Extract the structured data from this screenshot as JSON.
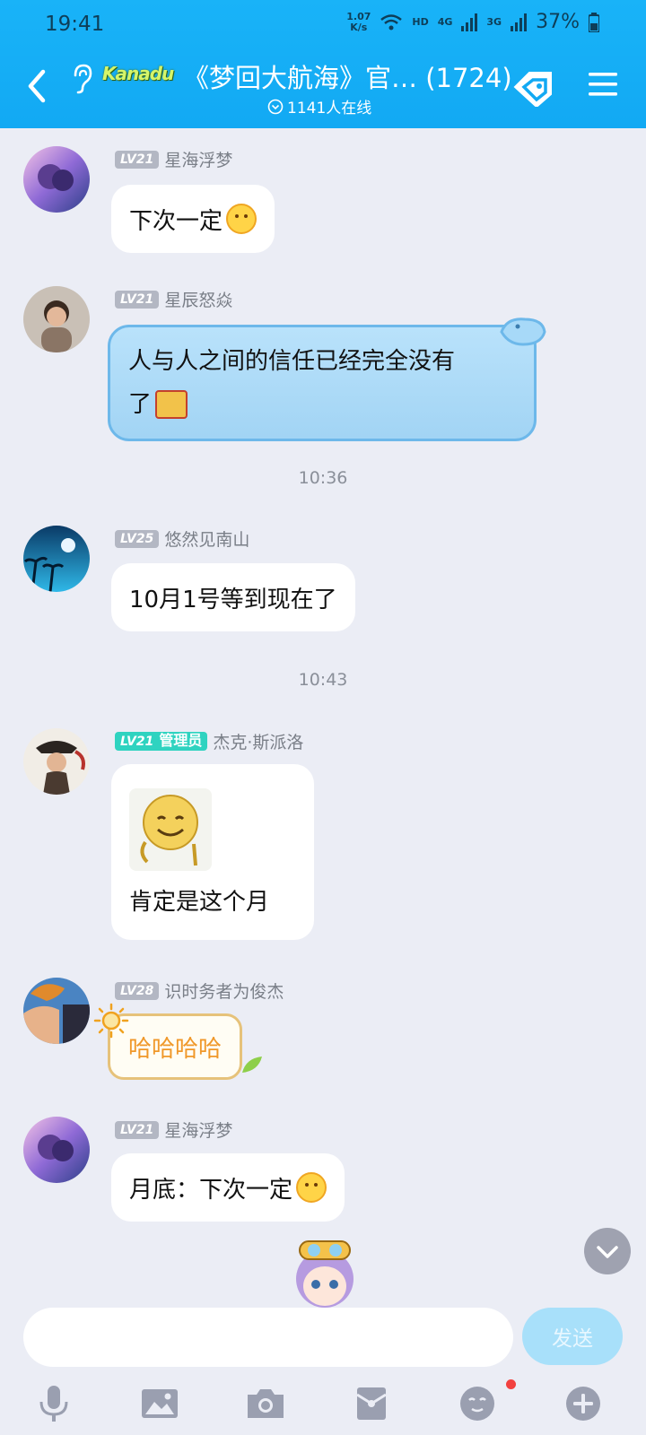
{
  "status_bar": {
    "time": "19:41",
    "net_speed_top": "1.07",
    "net_speed_bottom": "K/s",
    "hd": "HD",
    "net_4g": "4G",
    "net_3g": "3G",
    "battery": "37%"
  },
  "header": {
    "logo_text": "Kanadu",
    "title": "《梦回大航海》官…  (1724)",
    "online": "1141人在线"
  },
  "messages": [
    {
      "level": "LV21",
      "name": "星海浮梦",
      "text": "下次一定"
    },
    {
      "level": "LV21",
      "name": "星辰怒焱",
      "text_line1": "人与人之间的信任已经完全没有",
      "text_line2": "了"
    },
    {
      "level": "LV25",
      "name": "悠然见南山",
      "text": "10月1号等到现在了"
    },
    {
      "level": "LV21",
      "role": "管理员",
      "name": "杰克·斯派洛",
      "text": "肯定是这个月"
    },
    {
      "level": "LV28",
      "name": "识时务者为俊杰",
      "text": "哈哈哈哈"
    },
    {
      "level": "LV21",
      "name": "星海浮梦",
      "text": "月底：下次一定"
    }
  ],
  "timestamps": [
    "10:36",
    "10:43"
  ],
  "input": {
    "placeholder": "",
    "send_label": "发送"
  },
  "toolbar": {
    "icons": [
      "microphone-icon",
      "image-icon",
      "camera-icon",
      "red-packet-icon",
      "emoji-icon",
      "plus-icon"
    ]
  },
  "colors": {
    "header": "#12a9f3",
    "background": "#ebedf5",
    "admin_badge": "#2fd3c0",
    "send_button": "#a8e0fa"
  }
}
